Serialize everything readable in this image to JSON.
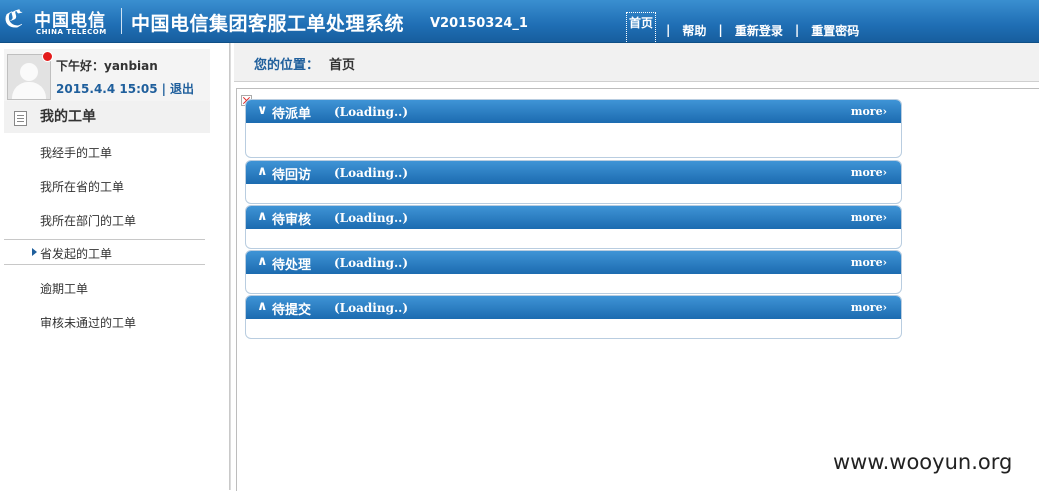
{
  "brand": {
    "logo_cn": "中国电信",
    "logo_en": "CHINA TELECOM"
  },
  "header": {
    "title": "中国电信集团客服工单处理系统",
    "version": "V20150324_1",
    "nav": [
      "首页",
      "帮助",
      "重新登录",
      "重置密码"
    ]
  },
  "user": {
    "greeting": "下午好：yanbian",
    "login_time": "2015.4.4 15:05",
    "logout": "退出"
  },
  "sidebar": {
    "title": "我的工单",
    "items": [
      {
        "label": "我经手的工单"
      },
      {
        "label": "我所在省的工单"
      },
      {
        "label": "我所在部门的工单"
      },
      {
        "label": "省发起的工单",
        "active": true
      },
      {
        "label": "逾期工单"
      },
      {
        "label": "审核未通过的工单"
      }
    ]
  },
  "breadcrumb": {
    "label": "您的位置：",
    "value": "首页"
  },
  "panels": [
    {
      "toggle": "∨",
      "title": "待派单",
      "status": "(Loading..)",
      "more": "more"
    },
    {
      "toggle": "∧",
      "title": "待回访",
      "status": "(Loading..)",
      "more": "more"
    },
    {
      "toggle": "∧",
      "title": "待审核",
      "status": "(Loading..)",
      "more": "more"
    },
    {
      "toggle": "∧",
      "title": "待处理",
      "status": "(Loading..)",
      "more": "more"
    },
    {
      "toggle": "∧",
      "title": "待提交",
      "status": "(Loading..)",
      "more": "more"
    }
  ],
  "watermark": "www.wooyun.org",
  "colors": {
    "header_blue": "#1f6eb4",
    "panel_blue": "#2a7fc4",
    "notify_red": "#e31b1b"
  }
}
